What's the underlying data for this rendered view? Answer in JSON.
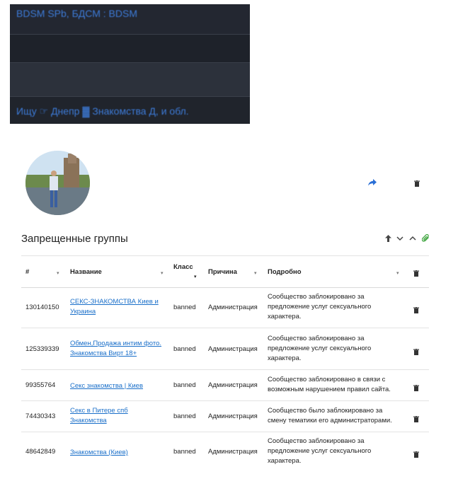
{
  "banner": {
    "top_text": "BDSM SPb, БДСМ : BDSM",
    "bottom_text": "Ищу ☞ Днепр ▓ Знакомства Д, и обл."
  },
  "section": {
    "title": "Запрещенные группы"
  },
  "table": {
    "headers": {
      "num": "#",
      "name": "Название",
      "class": "Класс",
      "reason": "Причина",
      "details": "Подробно"
    },
    "rows": [
      {
        "id": "130140150",
        "name": "СЕКС-ЗНАКОМСТВА Киев и Украина",
        "class": "banned",
        "reason": "Администрация",
        "details": "Сообщество заблокировано за предложение услуг сексуального характера."
      },
      {
        "id": "125339339",
        "name": "Обмен,Продажа интим фото. Знакомства Вирт 18+",
        "class": "banned",
        "reason": "Администрация",
        "details": "Сообщество заблокировано за предложение услуг сексуального характера."
      },
      {
        "id": "99355764",
        "name": "Секс знакомства | Киев",
        "class": "banned",
        "reason": "Администрация",
        "details": "Сообщество заблокировано в связи с возможным нарушением правил сайта."
      },
      {
        "id": "74430343",
        "name": "Секс в Питере спб Знакомства",
        "class": "banned",
        "reason": "Администрация",
        "details": "Сообщество было заблокировано за смену тематики его администраторами."
      },
      {
        "id": "48642849",
        "name": "Знакомства (Киев)",
        "class": "banned",
        "reason": "Администрация",
        "details": "Сообщество заблокировано за предложение услуг сексуального характера."
      }
    ]
  },
  "colors": {
    "link": "#1a6fc9",
    "share_icon": "#2a6fd6",
    "paperclip_icon": "#3aa33a",
    "banner_text": "#3d7bd8"
  }
}
